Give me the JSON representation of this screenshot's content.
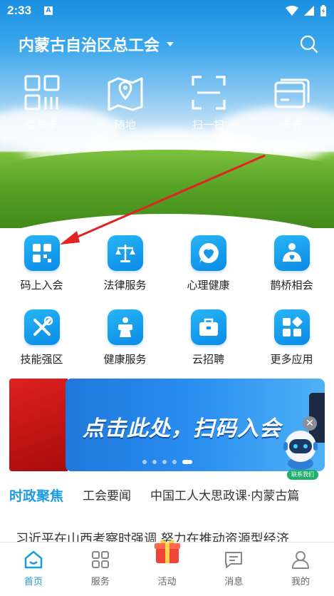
{
  "status_bar": {
    "time": "2:33",
    "notification_icon": "A"
  },
  "header": {
    "org_name": "内蒙古自治区总工会",
    "dropdown_icon": "caret-down-icon",
    "search_icon": "search-icon"
  },
  "quick_actions": [
    {
      "label": "会员卡",
      "icon": "member-card-icon"
    },
    {
      "label": "随地",
      "icon": "map-pin-icon"
    },
    {
      "label": "扫一扫",
      "icon": "scan-icon"
    },
    {
      "label": "卡券",
      "icon": "coupon-icon"
    }
  ],
  "services": [
    {
      "label": "码上入会",
      "icon": "qr-join-icon"
    },
    {
      "label": "法律服务",
      "icon": "scales-icon"
    },
    {
      "label": "心理健康",
      "icon": "heart-chat-icon"
    },
    {
      "label": "鹊桥相会",
      "icon": "couple-icon"
    },
    {
      "label": "技能强区",
      "icon": "tools-icon"
    },
    {
      "label": "健康服务",
      "icon": "health-icon"
    },
    {
      "label": "云招聘",
      "icon": "briefcase-icon"
    },
    {
      "label": "更多应用",
      "icon": "apps-icon"
    }
  ],
  "banner": {
    "text": "点击此处，扫码入会",
    "slides_total": 5,
    "active_slide": 5,
    "contact_label": "联系我们"
  },
  "news_tabs": [
    {
      "label": "时政聚焦",
      "active": true
    },
    {
      "label": "工会要闻",
      "active": false
    },
    {
      "label": "中国工人大思政课·内蒙古篇",
      "active": false
    }
  ],
  "news_headline": "习近平在山西考察时强调 努力在推动资源型经济",
  "bottom_nav": [
    {
      "label": "首页",
      "icon": "home-icon",
      "active": true
    },
    {
      "label": "服务",
      "icon": "services-icon",
      "active": false
    },
    {
      "label": "活动",
      "icon": "gift-icon",
      "active": false
    },
    {
      "label": "消息",
      "icon": "message-icon",
      "active": false
    },
    {
      "label": "我的",
      "icon": "profile-icon",
      "active": false
    }
  ],
  "colors": {
    "accent": "#1a9be8",
    "icon_gradient_top": "#28b5f5",
    "icon_gradient_bottom": "#0a8ae6",
    "annotation_arrow": "#e32222"
  }
}
